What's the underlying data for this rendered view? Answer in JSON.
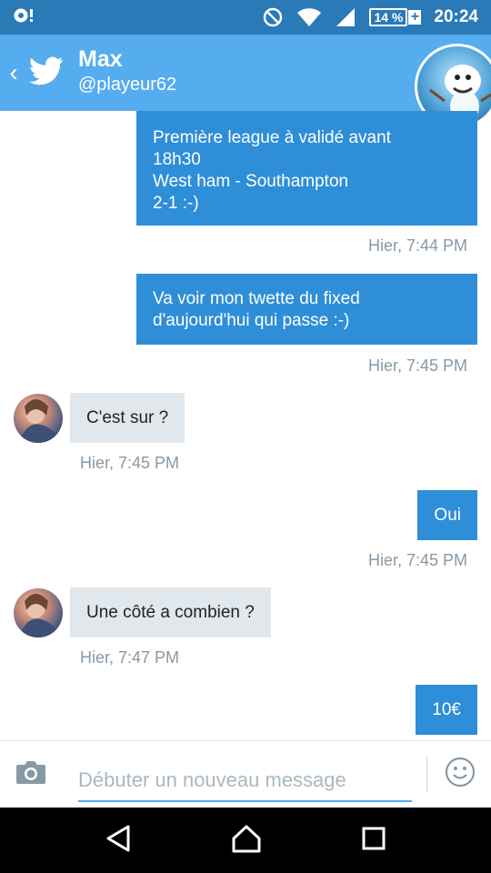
{
  "status_bar": {
    "time": "20:24",
    "battery": "14 %",
    "battery_plus": "+"
  },
  "header": {
    "back_glyph": "‹",
    "name": "Max",
    "handle": "@playeur62"
  },
  "messages": [
    {
      "direction": "out",
      "lines": [
        "Première league à validé avant",
        "18h30",
        "West ham - Southampton",
        "2-1 :-)"
      ],
      "time": "Hier, 7:44 PM"
    },
    {
      "direction": "out",
      "lines": [
        "Va voir mon twette du fixed",
        "d'aujourd'hui qui passe :-)"
      ],
      "time": "Hier, 7:45 PM"
    },
    {
      "direction": "in",
      "text": "C'est sur ?",
      "time": "Hier, 7:45 PM"
    },
    {
      "direction": "out",
      "text": "Oui",
      "time": "Hier, 7:45 PM"
    },
    {
      "direction": "in",
      "text": "Une côté a combien ?",
      "time": "Hier, 7:47 PM"
    },
    {
      "direction": "out",
      "text": "10€"
    }
  ],
  "composer": {
    "placeholder": "Débuter un nouveau message",
    "value": ""
  },
  "colors": {
    "status_bar": "#2b7ab8",
    "app_bar": "#55acee",
    "outgoing_bubble": "#2e8ed8",
    "incoming_bubble": "#e1e8ed",
    "timestamp": "#8899a6"
  },
  "icons": {
    "status_left": "notification-icon",
    "dnd": "do-not-disturb-icon",
    "wifi": "wifi-icon",
    "signal": "cell-signal-icon",
    "battery": "battery-icon",
    "header_logo": "twitter-bird-icon",
    "camera": "camera-icon",
    "emoji": "emoji-icon",
    "nav_back": "nav-back-icon",
    "nav_home": "nav-home-icon",
    "nav_recents": "nav-recents-icon"
  }
}
